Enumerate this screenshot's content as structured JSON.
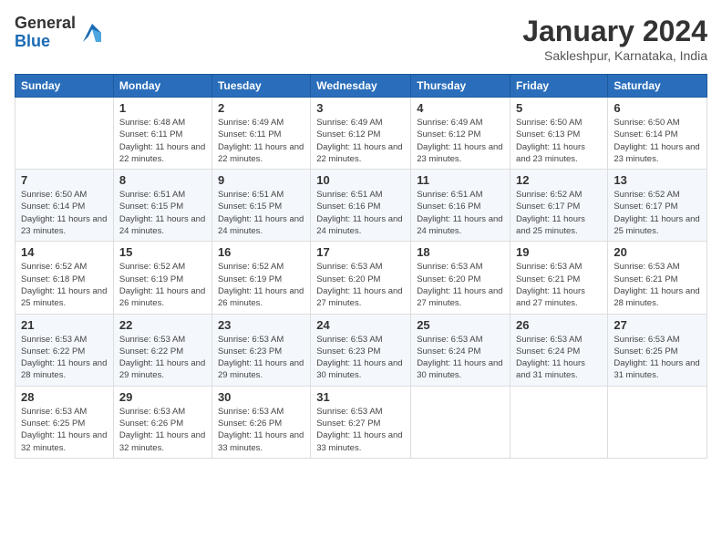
{
  "header": {
    "logo_general": "General",
    "logo_blue": "Blue",
    "month_year": "January 2024",
    "location": "Sakleshpur, Karnataka, India"
  },
  "days_of_week": [
    "Sunday",
    "Monday",
    "Tuesday",
    "Wednesday",
    "Thursday",
    "Friday",
    "Saturday"
  ],
  "weeks": [
    [
      {
        "day": "",
        "sunrise": "",
        "sunset": "",
        "daylight": ""
      },
      {
        "day": "1",
        "sunrise": "Sunrise: 6:48 AM",
        "sunset": "Sunset: 6:11 PM",
        "daylight": "Daylight: 11 hours and 22 minutes."
      },
      {
        "day": "2",
        "sunrise": "Sunrise: 6:49 AM",
        "sunset": "Sunset: 6:11 PM",
        "daylight": "Daylight: 11 hours and 22 minutes."
      },
      {
        "day": "3",
        "sunrise": "Sunrise: 6:49 AM",
        "sunset": "Sunset: 6:12 PM",
        "daylight": "Daylight: 11 hours and 22 minutes."
      },
      {
        "day": "4",
        "sunrise": "Sunrise: 6:49 AM",
        "sunset": "Sunset: 6:12 PM",
        "daylight": "Daylight: 11 hours and 23 minutes."
      },
      {
        "day": "5",
        "sunrise": "Sunrise: 6:50 AM",
        "sunset": "Sunset: 6:13 PM",
        "daylight": "Daylight: 11 hours and 23 minutes."
      },
      {
        "day": "6",
        "sunrise": "Sunrise: 6:50 AM",
        "sunset": "Sunset: 6:14 PM",
        "daylight": "Daylight: 11 hours and 23 minutes."
      }
    ],
    [
      {
        "day": "7",
        "sunrise": "Sunrise: 6:50 AM",
        "sunset": "Sunset: 6:14 PM",
        "daylight": "Daylight: 11 hours and 23 minutes."
      },
      {
        "day": "8",
        "sunrise": "Sunrise: 6:51 AM",
        "sunset": "Sunset: 6:15 PM",
        "daylight": "Daylight: 11 hours and 24 minutes."
      },
      {
        "day": "9",
        "sunrise": "Sunrise: 6:51 AM",
        "sunset": "Sunset: 6:15 PM",
        "daylight": "Daylight: 11 hours and 24 minutes."
      },
      {
        "day": "10",
        "sunrise": "Sunrise: 6:51 AM",
        "sunset": "Sunset: 6:16 PM",
        "daylight": "Daylight: 11 hours and 24 minutes."
      },
      {
        "day": "11",
        "sunrise": "Sunrise: 6:51 AM",
        "sunset": "Sunset: 6:16 PM",
        "daylight": "Daylight: 11 hours and 24 minutes."
      },
      {
        "day": "12",
        "sunrise": "Sunrise: 6:52 AM",
        "sunset": "Sunset: 6:17 PM",
        "daylight": "Daylight: 11 hours and 25 minutes."
      },
      {
        "day": "13",
        "sunrise": "Sunrise: 6:52 AM",
        "sunset": "Sunset: 6:17 PM",
        "daylight": "Daylight: 11 hours and 25 minutes."
      }
    ],
    [
      {
        "day": "14",
        "sunrise": "Sunrise: 6:52 AM",
        "sunset": "Sunset: 6:18 PM",
        "daylight": "Daylight: 11 hours and 25 minutes."
      },
      {
        "day": "15",
        "sunrise": "Sunrise: 6:52 AM",
        "sunset": "Sunset: 6:19 PM",
        "daylight": "Daylight: 11 hours and 26 minutes."
      },
      {
        "day": "16",
        "sunrise": "Sunrise: 6:52 AM",
        "sunset": "Sunset: 6:19 PM",
        "daylight": "Daylight: 11 hours and 26 minutes."
      },
      {
        "day": "17",
        "sunrise": "Sunrise: 6:53 AM",
        "sunset": "Sunset: 6:20 PM",
        "daylight": "Daylight: 11 hours and 27 minutes."
      },
      {
        "day": "18",
        "sunrise": "Sunrise: 6:53 AM",
        "sunset": "Sunset: 6:20 PM",
        "daylight": "Daylight: 11 hours and 27 minutes."
      },
      {
        "day": "19",
        "sunrise": "Sunrise: 6:53 AM",
        "sunset": "Sunset: 6:21 PM",
        "daylight": "Daylight: 11 hours and 27 minutes."
      },
      {
        "day": "20",
        "sunrise": "Sunrise: 6:53 AM",
        "sunset": "Sunset: 6:21 PM",
        "daylight": "Daylight: 11 hours and 28 minutes."
      }
    ],
    [
      {
        "day": "21",
        "sunrise": "Sunrise: 6:53 AM",
        "sunset": "Sunset: 6:22 PM",
        "daylight": "Daylight: 11 hours and 28 minutes."
      },
      {
        "day": "22",
        "sunrise": "Sunrise: 6:53 AM",
        "sunset": "Sunset: 6:22 PM",
        "daylight": "Daylight: 11 hours and 29 minutes."
      },
      {
        "day": "23",
        "sunrise": "Sunrise: 6:53 AM",
        "sunset": "Sunset: 6:23 PM",
        "daylight": "Daylight: 11 hours and 29 minutes."
      },
      {
        "day": "24",
        "sunrise": "Sunrise: 6:53 AM",
        "sunset": "Sunset: 6:23 PM",
        "daylight": "Daylight: 11 hours and 30 minutes."
      },
      {
        "day": "25",
        "sunrise": "Sunrise: 6:53 AM",
        "sunset": "Sunset: 6:24 PM",
        "daylight": "Daylight: 11 hours and 30 minutes."
      },
      {
        "day": "26",
        "sunrise": "Sunrise: 6:53 AM",
        "sunset": "Sunset: 6:24 PM",
        "daylight": "Daylight: 11 hours and 31 minutes."
      },
      {
        "day": "27",
        "sunrise": "Sunrise: 6:53 AM",
        "sunset": "Sunset: 6:25 PM",
        "daylight": "Daylight: 11 hours and 31 minutes."
      }
    ],
    [
      {
        "day": "28",
        "sunrise": "Sunrise: 6:53 AM",
        "sunset": "Sunset: 6:25 PM",
        "daylight": "Daylight: 11 hours and 32 minutes."
      },
      {
        "day": "29",
        "sunrise": "Sunrise: 6:53 AM",
        "sunset": "Sunset: 6:26 PM",
        "daylight": "Daylight: 11 hours and 32 minutes."
      },
      {
        "day": "30",
        "sunrise": "Sunrise: 6:53 AM",
        "sunset": "Sunset: 6:26 PM",
        "daylight": "Daylight: 11 hours and 33 minutes."
      },
      {
        "day": "31",
        "sunrise": "Sunrise: 6:53 AM",
        "sunset": "Sunset: 6:27 PM",
        "daylight": "Daylight: 11 hours and 33 minutes."
      },
      {
        "day": "",
        "sunrise": "",
        "sunset": "",
        "daylight": ""
      },
      {
        "day": "",
        "sunrise": "",
        "sunset": "",
        "daylight": ""
      },
      {
        "day": "",
        "sunrise": "",
        "sunset": "",
        "daylight": ""
      }
    ]
  ]
}
